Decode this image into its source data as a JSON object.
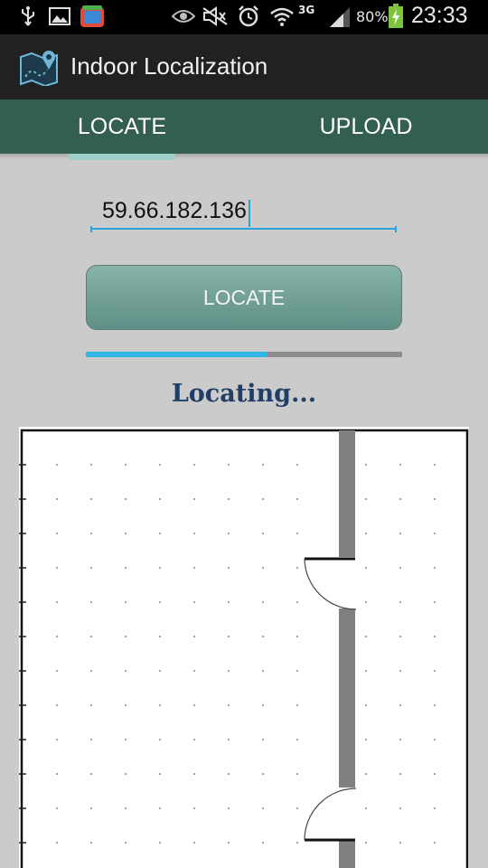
{
  "status_bar": {
    "battery_percent": "80%",
    "network_type": "3G",
    "time": "23:33",
    "icons": [
      "usb-icon",
      "gallery-icon",
      "app-store-icon",
      "eye-icon",
      "mute-icon",
      "alarm-icon",
      "wifi-icon",
      "signal-icon",
      "battery-charging-icon"
    ]
  },
  "action_bar": {
    "title": "Indoor Localization",
    "icon": "map-icon"
  },
  "tabs": [
    {
      "label": "LOCATE",
      "selected": true
    },
    {
      "label": "UPLOAD",
      "selected": false
    }
  ],
  "form": {
    "ip_value": "59.66.182.136",
    "locate_button_label": "LOCATE",
    "progress": 0.57,
    "status_text": "Locating..."
  },
  "colors": {
    "accent": "#33b5e5",
    "tab_bar": "#335f51",
    "button": "#72a097",
    "status_text": "#213f66"
  }
}
